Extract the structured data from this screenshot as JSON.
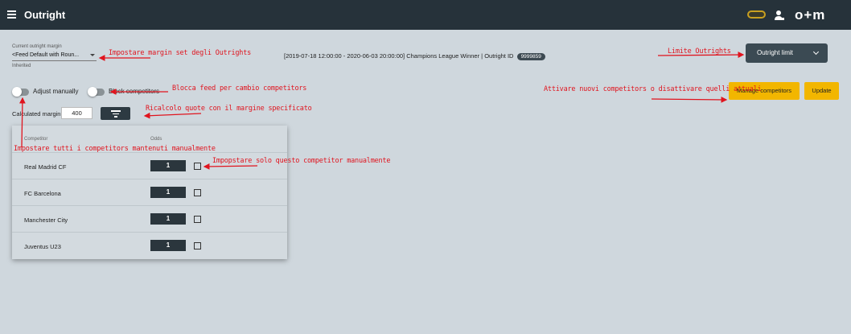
{
  "header": {
    "title": "Outright",
    "logo": "o+m",
    "icons": [
      "menu-icon",
      "toggle-icon",
      "user-settings-icon"
    ]
  },
  "margin": {
    "label": "Current outright margin",
    "value": "<Feed Default with Roun...",
    "sub": "Inherited"
  },
  "info": {
    "text": "[2019-07-18 12:00:00 - 2020-06-03 20:00:00] Champions League Winner | Outright ID",
    "id": "9999859"
  },
  "outright_limit": {
    "label": "Outright limit"
  },
  "switches": {
    "adjust": "Adjust manually",
    "block": "Block competitors"
  },
  "buttons": {
    "manage": "Manage competitors",
    "update": "Update"
  },
  "calculated": {
    "label": "Calculated margin",
    "value": "400"
  },
  "table": {
    "headers": {
      "competitor": "Competitor",
      "odds": "Odds"
    },
    "rows": [
      {
        "name": "Real Madrid CF",
        "odds": "1"
      },
      {
        "name": "FC Barcelona",
        "odds": "1"
      },
      {
        "name": "Manchester City",
        "odds": "1"
      },
      {
        "name": "Juventus U23",
        "odds": "1"
      }
    ]
  },
  "annotations": {
    "margin_set": "Impostare margin set degli Outrights",
    "limit": "Limite Outrights",
    "block_feed": "Blocca feed per cambio competitors",
    "activate": "Attivare nuovi competitors o disattivare quelli attuali",
    "recalc": "Ricalcolo quote con il margine specificato",
    "all_manual": "Impostare tutti i competitors mantenuti manualmente",
    "single_manual": "Impopstare solo questo competitor manualmente"
  },
  "colors": {
    "topbar": "#26323a",
    "background": "#cfd7dd",
    "accent_yellow": "#f2b600",
    "annotation_red": "#e0141e"
  }
}
